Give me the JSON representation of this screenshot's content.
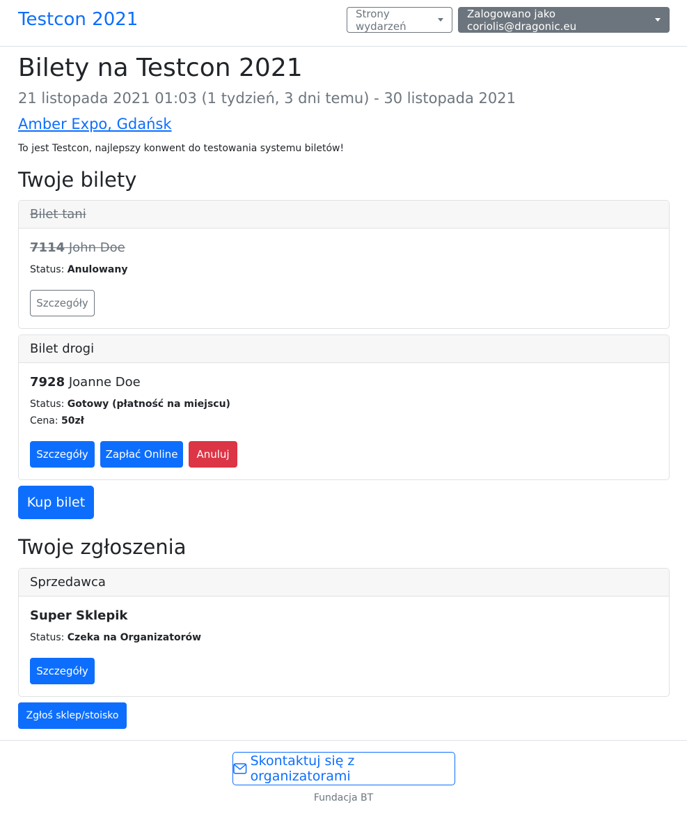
{
  "nav": {
    "brand": "Testcon 2021",
    "events_menu": "Strony wydarzeń",
    "user_menu": "Zalogowano jako coriolis@dragonic.eu"
  },
  "event": {
    "title": "Bilety na Testcon 2021",
    "dates": "21 listopada 2021 01:03 (1 tydzień, 3 dni temu) - 30 listopada 2021",
    "venue": "Amber Expo, Gdańsk",
    "description": "To jest Testcon, najlepszy konwent do testowania systemu biletów!"
  },
  "tickets_section": {
    "heading": "Twoje bilety",
    "tickets": [
      {
        "type": "Bilet tani",
        "number": "7114",
        "name": "John Doe",
        "status_label": "Status:",
        "status": "Anulowany",
        "details_button": "Szczegóły"
      },
      {
        "type": "Bilet drogi",
        "number": "7928",
        "name": "Joanne Doe",
        "status_label": "Status:",
        "status": "Gotowy (płatność na miejscu)",
        "price_label": "Cena:",
        "price": "50zł",
        "details_button": "Szczegóły",
        "pay_button": "Zapłać Online",
        "cancel_button": "Anuluj"
      }
    ],
    "buy_button": "Kup bilet"
  },
  "applications_section": {
    "heading": "Twoje zgłoszenia",
    "application": {
      "type": "Sprzedawca",
      "name": "Super Sklepik",
      "status_label": "Status:",
      "status": "Czeka na Organizatorów",
      "details_button": "Szczegóły"
    },
    "apply_button": "Zgłoś sklep/stoisko"
  },
  "footer": {
    "contact_button": "Skontaktuj się z organizatorami",
    "org": "Fundacja BT"
  },
  "colors": {
    "primary": "#0d6efd",
    "secondary": "#6c757d",
    "danger": "#dc3545"
  }
}
